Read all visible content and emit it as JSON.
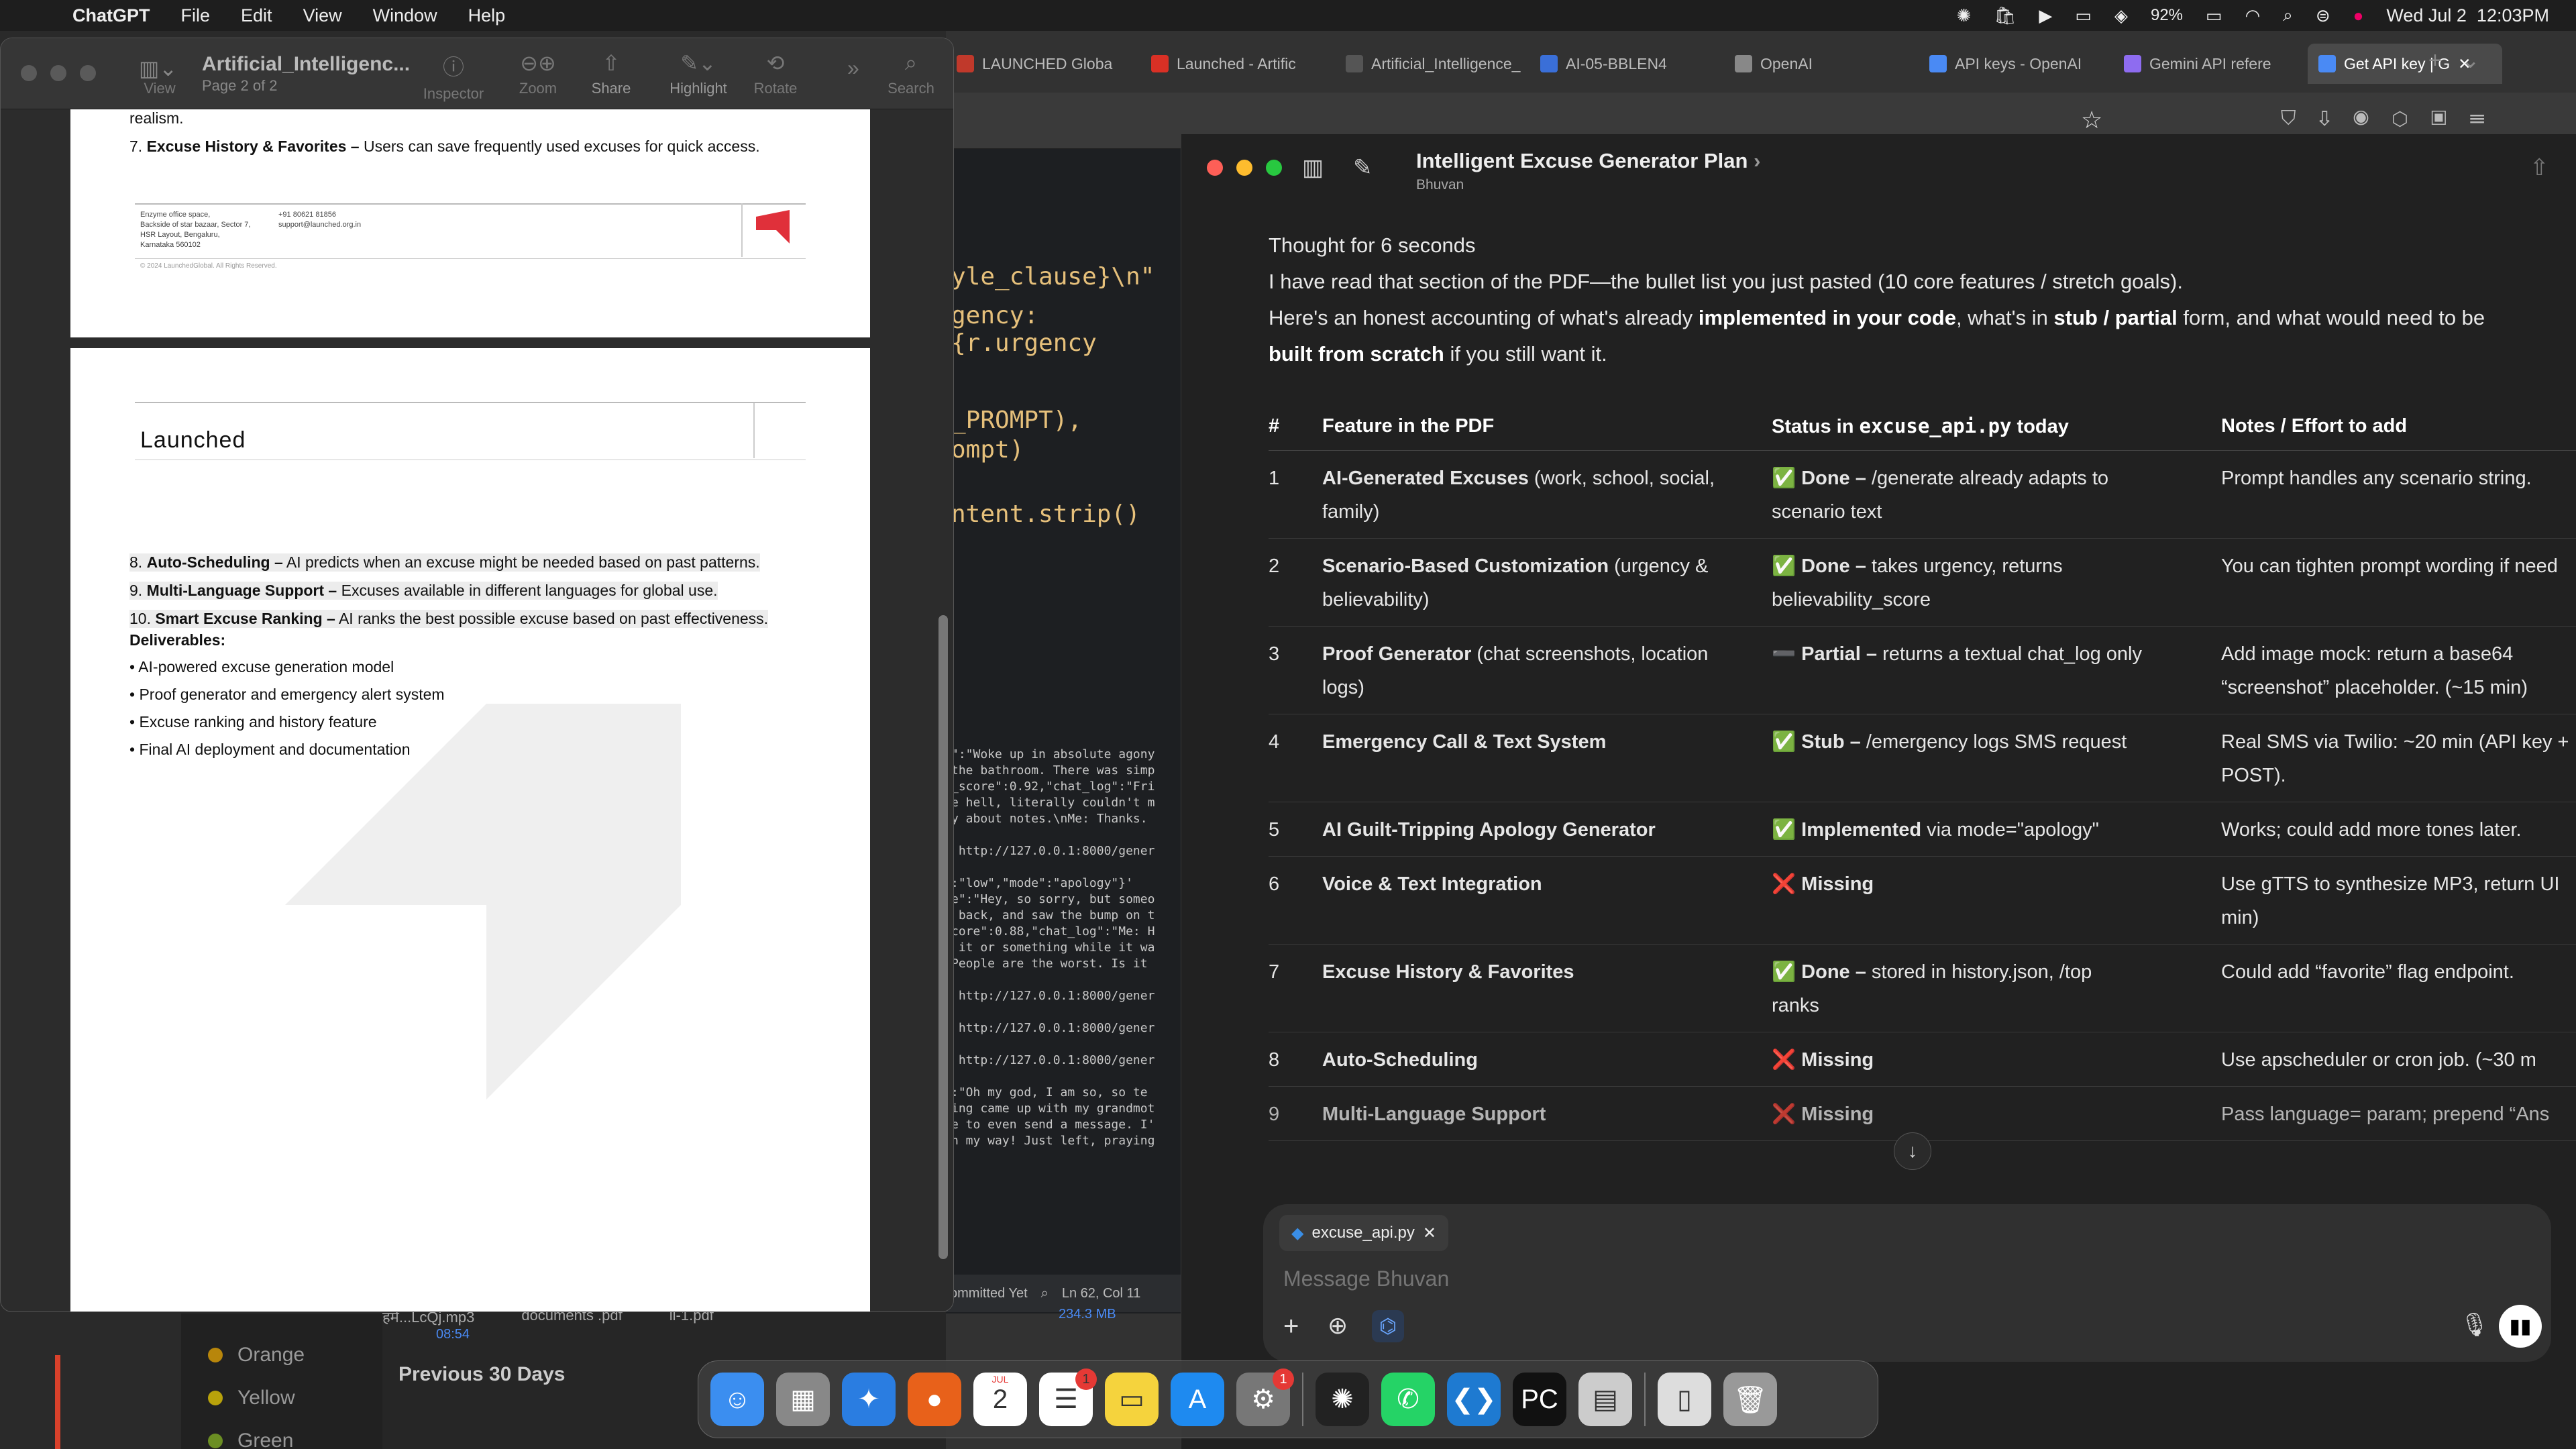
{
  "menubar": {
    "app": "ChatGPT",
    "items": [
      "File",
      "Edit",
      "View",
      "Window",
      "Help"
    ],
    "battery": "92%",
    "datetime": "Wed Jul 2  12:03PM"
  },
  "browser": {
    "tabs": [
      {
        "label": "LAUNCHED Globa",
        "color": "#c0392b"
      },
      {
        "label": "Launched - Artific",
        "color": "#d93025"
      },
      {
        "label": "Artificial_Intelligence_",
        "color": "#555555"
      },
      {
        "label": "AI-05-BBLEN4",
        "color": "#3a6fd8"
      },
      {
        "label": "OpenAI",
        "color": "#888888"
      },
      {
        "label": "API keys - OpenAI",
        "color": "#4a8af4"
      },
      {
        "label": "Gemini API refere",
        "color": "#8e6cf0"
      },
      {
        "label": "Get API key | G",
        "color": "#4a8af4"
      }
    ]
  },
  "editor": {
    "lines_big": [
      "yle_clause}\\n\"",
      "gency: {r.urgency",
      "_PROMPT),",
      "ompt)",
      "ntent.strip()"
    ],
    "lines_small": [
      "\":\"Woke up in absolute agony",
      "the bathroom. There was simp",
      "_score\":0.92,\"chat_log\":\"Fri",
      "e hell, literally couldn't m",
      "y about notes.\\nMe: Thanks.",
      "",
      " http://127.0.0.1:8000/gener",
      "",
      ":\"low\",\"mode\":\"apology\"}'",
      "e\":\"Hey, so sorry, but someo",
      " back, and saw the bump on t",
      "core\":0.88,\"chat_log\":\"Me: H",
      " it or something while it wa",
      "People are the worst. Is it",
      "",
      " http://127.0.0.1:8000/gener",
      "",
      " http://127.0.0.1:8000/gener",
      "",
      " http://127.0.0.1:8000/gener",
      "",
      ":\"Oh my god, I am so, so te",
      "ing came up with my grandmot",
      "e to even send a message. I'",
      "n my way! Just left, praying"
    ],
    "status_left": "ommitted Yet",
    "status_right": "Ln 62, Col 11"
  },
  "preview": {
    "title": "Artificial_Intelligenc...",
    "subtitle": "Page 2 of 2",
    "toolbar": [
      "View",
      "Inspector",
      "Zoom",
      "Share",
      "Highlight",
      "Rotate",
      "Search"
    ],
    "page1": {
      "line_top": "realism.",
      "item7_num": "7.",
      "item7_bold": "Excuse History & Favorites –",
      "item7_rest": " Users can save frequently used excuses for quick access.",
      "footer_addr": [
        "Enzyme office space,",
        "Backside of star bazaar, Sector 7,",
        "HSR Layout, Bengaluru,",
        "Karnataka 560102"
      ],
      "footer_contact": [
        "+91 80621 81856",
        "support@launched.org.in"
      ],
      "footer_copy": "© 2024 LaunchedGlobal. All Rights Reserved."
    },
    "page2": {
      "logo": "Launched",
      "items": [
        {
          "num": "8.",
          "bold": "Auto-Scheduling –",
          "rest": " AI predicts when an excuse might be needed based on past patterns."
        },
        {
          "num": "9.",
          "bold": "Multi-Language Support –",
          "rest": " Excuses available in different languages for global use."
        },
        {
          "num": "10.",
          "bold": "Smart Excuse Ranking –",
          "rest": " AI ranks the best possible excuse based on past effectiveness."
        }
      ],
      "deliverables_title": "Deliverables:",
      "deliverables": [
        "• AI-powered excuse generation model",
        "• Proof generator and emergency alert system",
        "• Excuse ranking and history feature",
        "• Final AI deployment and documentation"
      ]
    }
  },
  "chat": {
    "title": "Intelligent Excuse Generator Plan",
    "user": "Bhuvan",
    "thought": "Thought for 6 seconds",
    "intro1": "I have read that section of the PDF—the bullet list you just pasted (10 core features / stretch goals).",
    "intro2a": "Here's an honest accounting of what's already ",
    "intro2b": "implemented in your code",
    "intro2c": ", what's in ",
    "intro2d": "stub / partial",
    "intro2e": " form, and what would need to be",
    "intro3a": "built from scratch",
    "intro3b": " if you still want it.",
    "headers": {
      "num": "#",
      "feature": "Feature in the PDF",
      "status_a": "Status in ",
      "status_code": "excuse_api.py",
      "status_b": " today",
      "notes": "Notes / Effort to add"
    },
    "rows": [
      {
        "num": "1",
        "feature_b": "AI-Generated Excuses",
        "feature_r": " (work, school, social,",
        "feature_r2": "family)",
        "mark": "✅",
        "status_b": "Done –",
        "status_r": " /generate already adapts to",
        "status_r2": "scenario text",
        "notes": "Prompt handles any scenario string.",
        "notes2": ""
      },
      {
        "num": "2",
        "feature_b": "Scenario-Based Customization",
        "feature_r": " (urgency &",
        "feature_r2": "believability)",
        "mark": "✅",
        "status_b": "Done –",
        "status_r": " takes urgency, returns",
        "status_r2": "believability_score",
        "notes": "You can tighten prompt wording if need",
        "notes2": ""
      },
      {
        "num": "3",
        "feature_b": "Proof Generator",
        "feature_r": " (chat screenshots, location",
        "feature_r2": "logs)",
        "mark": "➖",
        "status_b": "Partial –",
        "status_r": " returns a textual chat_log only",
        "status_r2": "",
        "notes": "Add image mock: return a base64",
        "notes2": "“screenshot” placeholder. (~15 min)"
      },
      {
        "num": "4",
        "feature_b": "Emergency Call & Text System",
        "feature_r": "",
        "feature_r2": "",
        "mark": "✅",
        "status_b": "Stub –",
        "status_r": " /emergency logs SMS request",
        "status_r2": "",
        "notes": "Real SMS via Twilio: ~20 min (API key +",
        "notes2": "POST)."
      },
      {
        "num": "5",
        "feature_b": "AI Guilt-Tripping Apology Generator",
        "feature_r": "",
        "feature_r2": "",
        "mark": "✅",
        "status_b": "Implemented",
        "status_r": " via mode=\"apology\"",
        "status_r2": "",
        "notes": "Works; could add more tones later.",
        "notes2": ""
      },
      {
        "num": "6",
        "feature_b": "Voice & Text Integration",
        "feature_r": "",
        "feature_r2": "",
        "mark": "❌",
        "status_b": "Missing",
        "status_r": "",
        "status_r2": "",
        "notes": "Use gTTS to synthesize MP3, return UI",
        "notes2": "min)"
      },
      {
        "num": "7",
        "feature_b": "Excuse History & Favorites",
        "feature_r": "",
        "feature_r2": "",
        "mark": "✅",
        "status_b": "Done –",
        "status_r": " stored in history.json, /top",
        "status_r2": "ranks",
        "notes": "Could add “favorite” flag endpoint.",
        "notes2": ""
      },
      {
        "num": "8",
        "feature_b": "Auto-Scheduling",
        "feature_r": "",
        "feature_r2": "",
        "mark": "❌",
        "status_b": "Missing",
        "status_r": "",
        "status_r2": "",
        "notes": "Use apscheduler or cron job. (~30 m",
        "notes2": ""
      },
      {
        "num": "9",
        "feature_b": "Multi-Language Support",
        "feature_r": "",
        "feature_r2": "",
        "mark": "❌",
        "status_b": "Missing",
        "status_r": "",
        "status_r2": "",
        "notes": "Pass language= param; prepend “Ans",
        "notes2": ""
      }
    ],
    "attachment": "excuse_api.py",
    "placeholder": "Message Bhuvan"
  },
  "background": {
    "sidebar_labels": [
      "Orange",
      "Yellow",
      "Green"
    ],
    "sidebar_colors": [
      "#b8860b",
      "#b8a20b",
      "#6b8e23"
    ],
    "prev30": "Previous 30 Days",
    "files": [
      "हमें...LcQj.mp3",
      "documents .pdf",
      "li-1.pdf"
    ],
    "file_meta1": "08:54",
    "file_meta2": "234.3 MB"
  },
  "dock": {
    "apps": [
      {
        "name": "finder-icon",
        "color": "#3b8ef0",
        "glyph": "☺"
      },
      {
        "name": "launchpad-icon",
        "color": "#888888",
        "glyph": "▦"
      },
      {
        "name": "safari-icon",
        "color": "#2a7de1",
        "glyph": "✦"
      },
      {
        "name": "firefox-icon",
        "color": "#e8611a",
        "glyph": "●"
      },
      {
        "name": "calendar-icon",
        "color": "#ffffff",
        "glyph": "2"
      },
      {
        "name": "reminders-icon",
        "color": "#ffffff",
        "glyph": "☰"
      },
      {
        "name": "notes-icon",
        "color": "#f5d33d",
        "glyph": "▭"
      },
      {
        "name": "app-store-icon",
        "color": "#1e8af0",
        "glyph": "A"
      },
      {
        "name": "system-settings-icon",
        "color": "#777777",
        "glyph": "⚙"
      },
      {
        "name": "chatgpt-icon",
        "color": "#222222",
        "glyph": "✺"
      },
      {
        "name": "whatsapp-icon",
        "color": "#25d366",
        "glyph": "✆"
      },
      {
        "name": "vscode-icon",
        "color": "#1e7ad1",
        "glyph": "❮❯"
      },
      {
        "name": "pycharm-icon",
        "color": "#111111",
        "glyph": "PC"
      },
      {
        "name": "preview-icon",
        "color": "#cccccc",
        "glyph": "▤"
      },
      {
        "name": "documents-icon",
        "color": "#dddddd",
        "glyph": "▯"
      },
      {
        "name": "trash-icon",
        "color": "#999999",
        "glyph": "🗑"
      }
    ],
    "calendar_month": "JUL",
    "badges": {
      "reminders": "1",
      "settings": "1"
    }
  }
}
